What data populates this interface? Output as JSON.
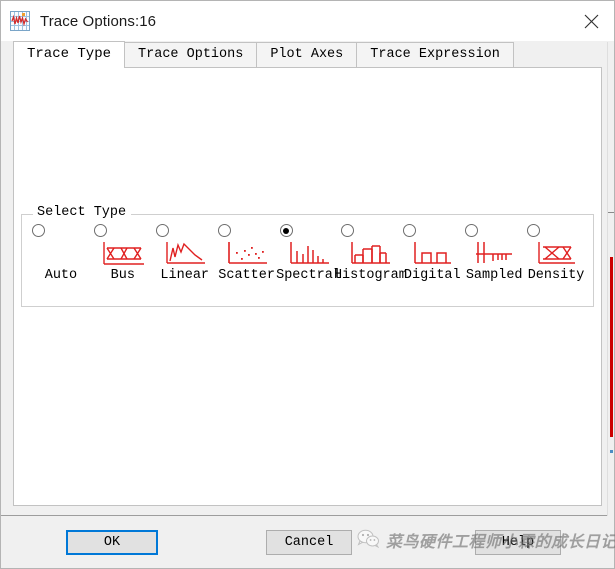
{
  "window": {
    "title": "Trace Options:16",
    "app_icon": "waveform-plot-icon",
    "close_icon": "close-icon",
    "accent_color": "#0078d7",
    "icon_color": "#e02020"
  },
  "tabs": [
    {
      "label": "Trace Type",
      "name": "tab-trace-type",
      "active": true
    },
    {
      "label": "Trace Options",
      "name": "tab-trace-options",
      "active": false
    },
    {
      "label": "Plot Axes",
      "name": "tab-plot-axes",
      "active": false
    },
    {
      "label": "Trace Expression",
      "name": "tab-trace-expression",
      "active": false
    }
  ],
  "select_type": {
    "legend": "Select Type",
    "options": [
      {
        "label": "Auto",
        "icon": "none",
        "selected": false
      },
      {
        "label": "Bus",
        "icon": "bus-icon",
        "selected": false
      },
      {
        "label": "Linear",
        "icon": "linear-icon",
        "selected": false
      },
      {
        "label": "Scatter",
        "icon": "scatter-icon",
        "selected": false
      },
      {
        "label": "Spectral",
        "icon": "spectral-icon",
        "selected": true
      },
      {
        "label": "Histogram",
        "icon": "histogram-icon",
        "selected": false
      },
      {
        "label": "Digital",
        "icon": "digital-icon",
        "selected": false
      },
      {
        "label": "Sampled",
        "icon": "sampled-icon",
        "selected": false
      },
      {
        "label": "Density",
        "icon": "density-icon",
        "selected": false
      }
    ]
  },
  "buttons": {
    "ok": "OK",
    "cancel": "Cancel",
    "help": "Help"
  },
  "watermark": {
    "text": "菜鸟硬件工程师小霖的成长日记",
    "icon": "wechat-icon"
  }
}
